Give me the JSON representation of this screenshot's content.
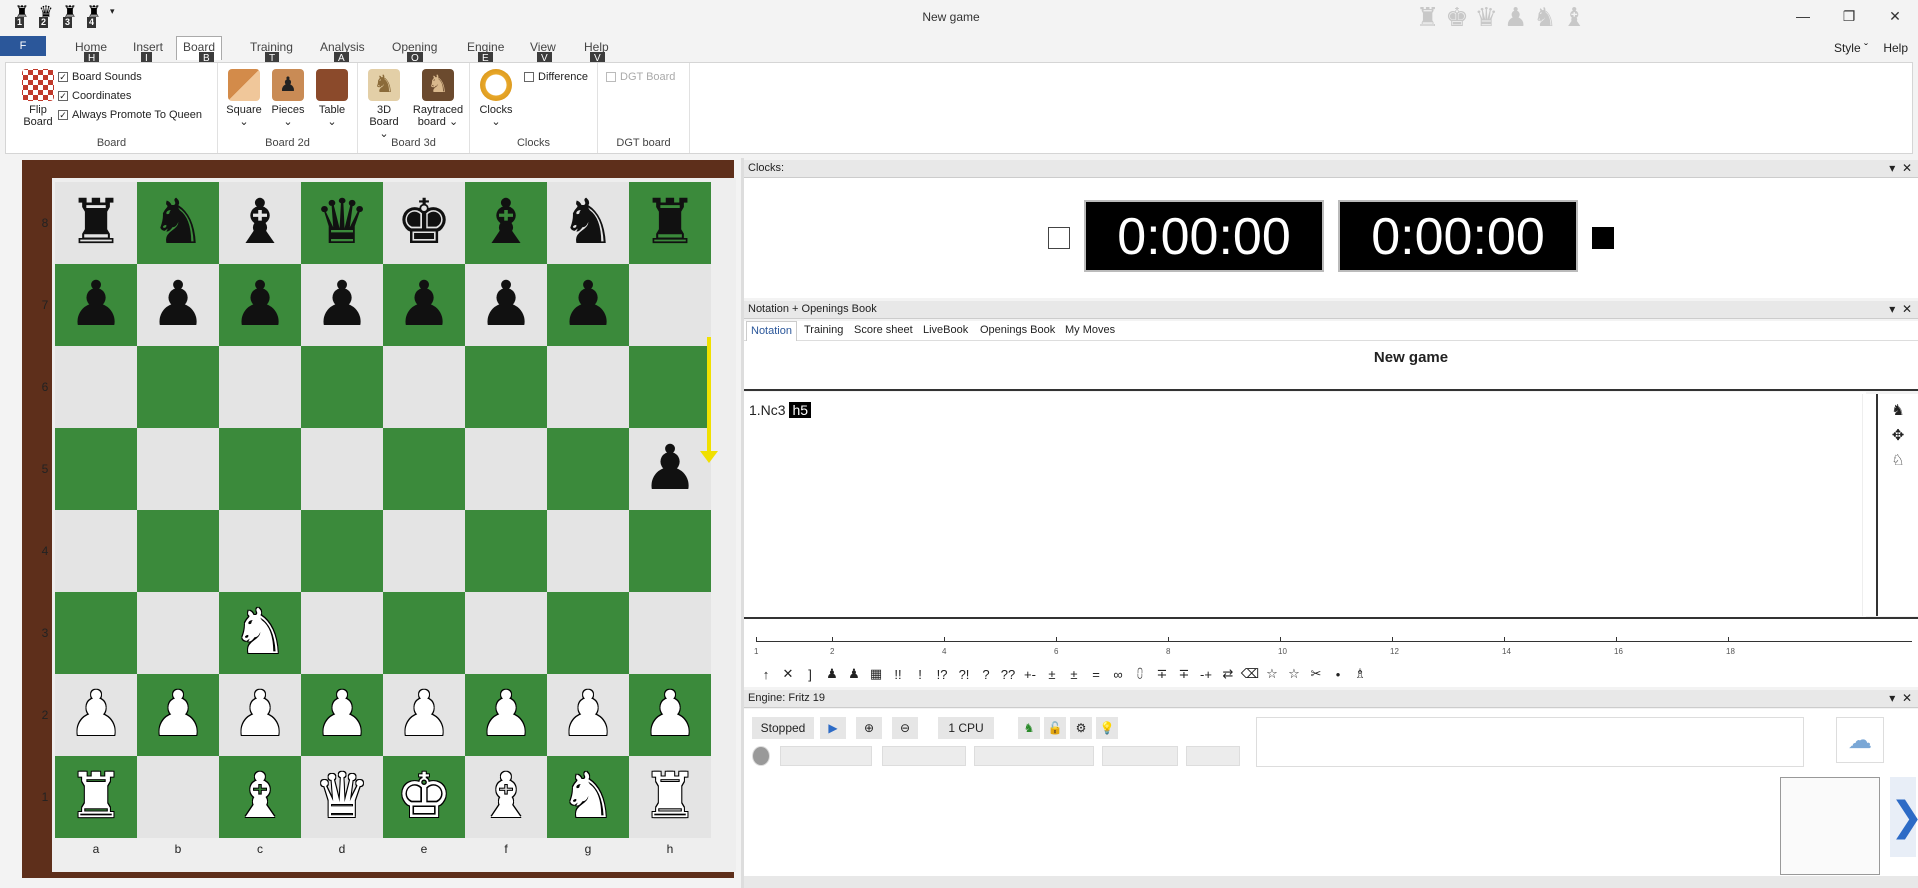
{
  "window": {
    "title": "New game",
    "quick_access": [
      "1",
      "2",
      "3",
      "4"
    ],
    "controls": [
      "—",
      "❐",
      "✕"
    ]
  },
  "ribbon_tabs": {
    "file": "F",
    "tabs": [
      "Home",
      "Insert",
      "Board",
      "Training",
      "Analysis",
      "Opening",
      "Engine",
      "View",
      "Help"
    ],
    "keytips": [
      "H",
      "I",
      "B",
      "T",
      "A",
      "O",
      "E",
      "V",
      "V"
    ],
    "active": "Board",
    "style": "Style",
    "help": "Help"
  },
  "ribbon": {
    "board_group": {
      "label": "Board",
      "flip": "Flip\nBoard",
      "checks": [
        {
          "label": "Board Sounds",
          "checked": true
        },
        {
          "label": "Coordinates",
          "checked": true
        },
        {
          "label": "Always Promote To Queen",
          "checked": true
        }
      ]
    },
    "board2d_group": {
      "label": "Board 2d",
      "buttons": [
        "Square",
        "Pieces",
        "Table"
      ]
    },
    "board3d_group": {
      "label": "Board 3d",
      "buttons": [
        "3D\nBoard",
        "Raytraced\nboard"
      ]
    },
    "clocks_group": {
      "label": "Clocks",
      "button": "Clocks",
      "difference": "Difference"
    },
    "dgt_group": {
      "label": "DGT board",
      "dgt": "DGT Board"
    }
  },
  "board": {
    "ranks": [
      "8",
      "7",
      "6",
      "5",
      "4",
      "3",
      "2",
      "1"
    ],
    "files": [
      "a",
      "b",
      "c",
      "d",
      "e",
      "f",
      "g",
      "h"
    ],
    "position": [
      [
        "br",
        "bn",
        "bb",
        "bq",
        "bk",
        "bb",
        "bn",
        "br"
      ],
      [
        "bp",
        "bp",
        "bp",
        "bp",
        "bp",
        "bp",
        "bp",
        ""
      ],
      [
        "",
        "",
        "",
        "",
        "",
        "",
        "",
        ""
      ],
      [
        "",
        "",
        "",
        "",
        "",
        "",
        "",
        "bp"
      ],
      [
        "",
        "",
        "",
        "",
        "",
        "",
        "",
        ""
      ],
      [
        "",
        "",
        "wn",
        "",
        "",
        "",
        "",
        ""
      ],
      [
        "wp",
        "wp",
        "wp",
        "wp",
        "wp",
        "wp",
        "wp",
        "wp"
      ],
      [
        "wr",
        "",
        "wb",
        "wq",
        "wk",
        "wb",
        "wn",
        "wr"
      ]
    ],
    "last_move_arrow": {
      "from": "h7",
      "to": "h5",
      "color": "#f0e000"
    }
  },
  "clocks_panel": {
    "title": "Clocks:",
    "white_time": "0:00:00",
    "black_time": "0:00:00"
  },
  "notation_panel": {
    "title": "Notation + Openings Book",
    "tabs": [
      "Notation",
      "Training",
      "Score sheet",
      "LiveBook",
      "Openings Book",
      "My Moves"
    ],
    "active_tab": "Notation",
    "game_title": "New game",
    "moves": {
      "first": "1.Nc3",
      "current": "h5"
    },
    "timeline_labels": [
      "1",
      "2",
      "4",
      "6",
      "8",
      "10",
      "12",
      "14",
      "16",
      "18"
    ],
    "symbols": [
      "↑",
      "✕",
      "]",
      "♟",
      "♟",
      "▦",
      "!!",
      "!",
      "!?",
      "?!",
      "?",
      "??",
      "+-",
      "±",
      "±",
      "=",
      "∞",
      "⩇",
      "∓",
      "∓",
      "-+",
      "⇄",
      "⌫",
      "☆",
      "☆",
      "✂",
      "•",
      "♗"
    ]
  },
  "engine_panel": {
    "title": "Engine: Fritz 19",
    "status": "Stopped",
    "cpu": "1 CPU"
  },
  "colors": {
    "accent": "#2b579a",
    "dark_square": "#3b8a3b",
    "light_square": "#e4e4e4",
    "frame": "#5e2f1b"
  }
}
